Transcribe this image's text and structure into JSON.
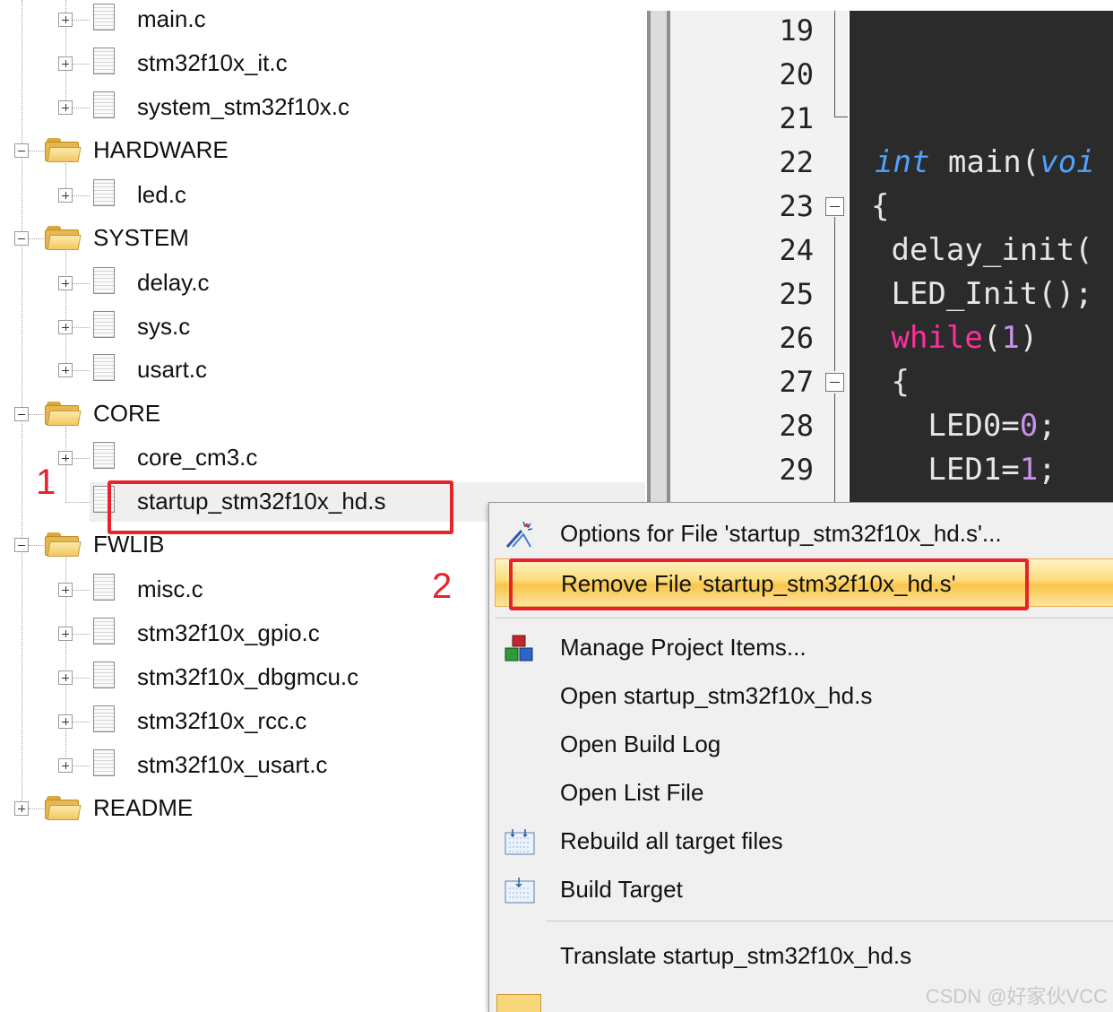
{
  "tree": {
    "items": [
      {
        "label": "main.c",
        "type": "file"
      },
      {
        "label": "stm32f10x_it.c",
        "type": "file"
      },
      {
        "label": "system_stm32f10x.c",
        "type": "file"
      },
      {
        "label": "HARDWARE",
        "type": "folder"
      },
      {
        "label": "led.c",
        "type": "file"
      },
      {
        "label": "SYSTEM",
        "type": "folder"
      },
      {
        "label": "delay.c",
        "type": "file"
      },
      {
        "label": "sys.c",
        "type": "file"
      },
      {
        "label": "usart.c",
        "type": "file"
      },
      {
        "label": "CORE",
        "type": "folder"
      },
      {
        "label": "core_cm3.c",
        "type": "file"
      },
      {
        "label": "startup_stm32f10x_hd.s",
        "type": "file",
        "selected": true
      },
      {
        "label": "FWLIB",
        "type": "folder"
      },
      {
        "label": "misc.c",
        "type": "file"
      },
      {
        "label": "stm32f10x_gpio.c",
        "type": "file"
      },
      {
        "label": "stm32f10x_dbgmcu.c",
        "type": "file"
      },
      {
        "label": "stm32f10x_rcc.c",
        "type": "file"
      },
      {
        "label": "stm32f10x_usart.c",
        "type": "file"
      },
      {
        "label": "README",
        "type": "folder"
      }
    ]
  },
  "annotations": {
    "step1": "1",
    "step2": "2",
    "color": "#e8222a"
  },
  "editor": {
    "line_numbers": [
      "19",
      "20",
      "21",
      "22",
      "23",
      "24",
      "25",
      "26",
      "27",
      "28",
      "29"
    ],
    "code": {
      "l22_kw": "int",
      "l22_name": " main(",
      "l22_param": "voi",
      "l23": "{",
      "l24": " delay_init(",
      "l25": " LED_Init();",
      "l26_kw": " while",
      "l26_open": "(",
      "l26_num": "1",
      "l26_close": ")",
      "l27": " {",
      "l28_pre": "   LED0=",
      "l28_num": "0",
      "l28_post": ";",
      "l29_pre": "   LED1=",
      "l29_num": "1",
      "l29_post": ";"
    }
  },
  "context_menu": {
    "options": "Options for File 'startup_stm32f10x_hd.s'...",
    "remove": "Remove File 'startup_stm32f10x_hd.s'",
    "manage": "Manage Project Items...",
    "open_file": "Open startup_stm32f10x_hd.s",
    "open_build_log": "Open Build Log",
    "open_list_file": "Open List File",
    "rebuild": "Rebuild all target files",
    "build": "Build Target",
    "translate": "Translate startup_stm32f10x_hd.s",
    "icons": {
      "options": "wand-icon",
      "manage": "blocks-icon",
      "rebuild": "rebuild-icon",
      "build": "build-icon",
      "partial": "checkmark-icon"
    }
  },
  "watermark": "CSDN @好家伙VCC"
}
